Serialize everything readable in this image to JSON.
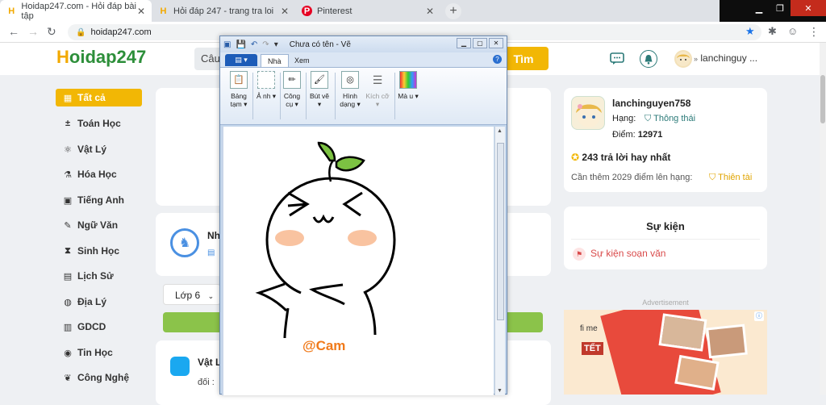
{
  "browser": {
    "tabs": [
      {
        "label": "Hoidap247.com - Hỏi đáp bài tập",
        "favicon": "H",
        "active": true
      },
      {
        "label": "Hỏi đáp 247 - trang tra loi",
        "favicon": "H",
        "active": false
      },
      {
        "label": "Pinterest",
        "favicon": "P",
        "active": false
      }
    ],
    "new_tab": "+",
    "url": "hoidap247.com"
  },
  "site": {
    "logo_h": "H",
    "logo_rest": "oidap247",
    "search_placeholder": "Câu",
    "search_button": "Tìm",
    "username": "lanchinguy ..."
  },
  "sidebar": {
    "items": [
      {
        "label": "Tất cả",
        "icon": "grid-icon"
      },
      {
        "label": "Toán Học",
        "icon": "math-icon"
      },
      {
        "label": "Vật Lý",
        "icon": "atom-icon"
      },
      {
        "label": "Hóa Học",
        "icon": "flask-icon"
      },
      {
        "label": "Tiếng Anh",
        "icon": "language-icon"
      },
      {
        "label": "Ngữ Văn",
        "icon": "pen-icon"
      },
      {
        "label": "Sinh Học",
        "icon": "dna-icon"
      },
      {
        "label": "Lịch Sử",
        "icon": "scroll-icon"
      },
      {
        "label": "Địa Lý",
        "icon": "globe-icon"
      },
      {
        "label": "GDCD",
        "icon": "book-icon"
      },
      {
        "label": "Tin Học",
        "icon": "computer-icon"
      },
      {
        "label": "Công Nghệ",
        "icon": "gear-icon"
      }
    ]
  },
  "main": {
    "filter_label": "Lớp 6",
    "question_title_prefix": "Nh",
    "question2_subject": "Vật L",
    "question2_text": "đối :"
  },
  "profile": {
    "name": "lanchinguyen758",
    "rank_label": "Hạng:",
    "rank_value": "Thông thái",
    "points_label": "Điểm:",
    "points_value": "12971",
    "best_answers": "243 trả lời hay nhất",
    "next_rank_text": "Cần thêm 2029 điểm lên hạng:",
    "next_rank_value": "Thiên tài"
  },
  "events": {
    "title": "Sự kiện",
    "item": "Sự kiện soạn văn"
  },
  "ad": {
    "label": "Advertisement",
    "text1": "fi me",
    "text2": "TẾT"
  },
  "paint": {
    "title": "Chưa có tên - Vẽ",
    "file_button": "▤ ▾",
    "tab_home": "Nhà",
    "tab_view": "Xem",
    "tools": [
      {
        "label": "Bảng tạm ▾",
        "icon": "clipboard-icon"
      },
      {
        "label": "Ả nh ▾",
        "icon": "image-icon"
      },
      {
        "label": "Công cụ ▾",
        "icon": "tools-icon"
      },
      {
        "label": "Bút vẽ ▾",
        "icon": "brush-icon"
      },
      {
        "label": "Hình dạng ▾",
        "icon": "shapes-icon"
      },
      {
        "label": "Kích cỡ ▾",
        "icon": "size-icon"
      },
      {
        "label": "Mà u ▾",
        "icon": "palette-icon"
      }
    ],
    "signature": "@Cam"
  },
  "colors": {
    "accent": "#f2b705",
    "green": "#8bc34a",
    "signature": "#f07a1a",
    "blush": "#f9c3a0",
    "leaf": "#7cc242"
  }
}
